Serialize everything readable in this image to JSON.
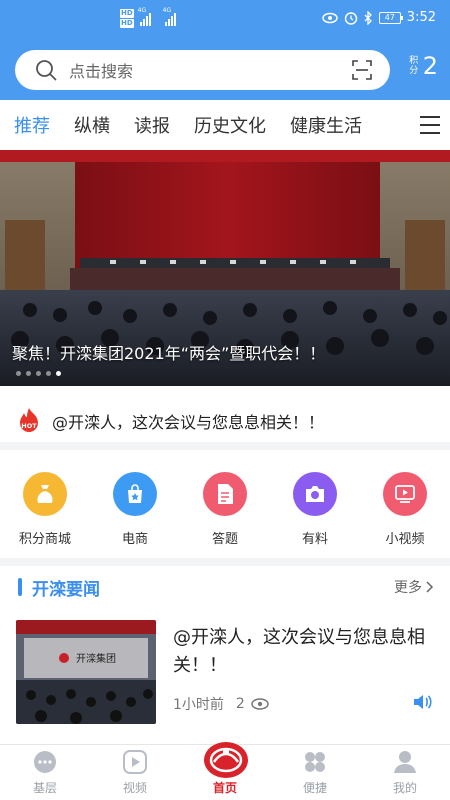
{
  "status_bar": {
    "time": "3:52",
    "battery": "47",
    "network_tags": [
      "HD",
      "HD"
    ],
    "signal_labels": [
      "4G",
      "4G"
    ]
  },
  "search": {
    "placeholder": "点击搜索"
  },
  "points": {
    "label": "积分",
    "value": "2"
  },
  "tabs": [
    {
      "label": "推荐",
      "active": true
    },
    {
      "label": "纵横",
      "active": false
    },
    {
      "label": "读报",
      "active": false
    },
    {
      "label": "历史文化",
      "active": false
    },
    {
      "label": "健康生活",
      "active": false
    }
  ],
  "banner": {
    "caption": "聚焦！开滦集团2021年“两会”暨职代会！！",
    "slide_count": 5,
    "active_slide": 5
  },
  "hotline": {
    "badge": "HOT",
    "text": "@开滦人，这次会议与您息息相关！！"
  },
  "shortcuts": [
    {
      "label": "积分商城",
      "icon": "money-bag-icon",
      "color": "#f6b733"
    },
    {
      "label": "电商",
      "icon": "shopping-bag-icon",
      "color": "#3d9bf3"
    },
    {
      "label": "答题",
      "icon": "document-icon",
      "color": "#f05b6f"
    },
    {
      "label": "有料",
      "icon": "camera-icon",
      "color": "#8b5cf0"
    },
    {
      "label": "小视频",
      "icon": "video-icon",
      "color": "#f05b6f"
    }
  ],
  "section": {
    "title": "开滦要闻",
    "more": "更多"
  },
  "news": {
    "title": "@开滦人，这次会议与您息息相关！！",
    "time": "1小时前",
    "views": "2",
    "thumb_caption": "开滦集团"
  },
  "bottom_nav": [
    {
      "label": "基层",
      "icon": "chat-bubble-icon",
      "active": false
    },
    {
      "label": "视频",
      "icon": "play-icon",
      "active": false
    },
    {
      "label": "首页",
      "icon": "home-logo-icon",
      "active": true
    },
    {
      "label": "便捷",
      "icon": "apps-icon",
      "active": false
    },
    {
      "label": "我的",
      "icon": "user-icon",
      "active": false
    }
  ],
  "colors": {
    "header_blue": "#4b9bf0",
    "accent_blue": "#3b8fee",
    "active_red": "#d8232a"
  }
}
